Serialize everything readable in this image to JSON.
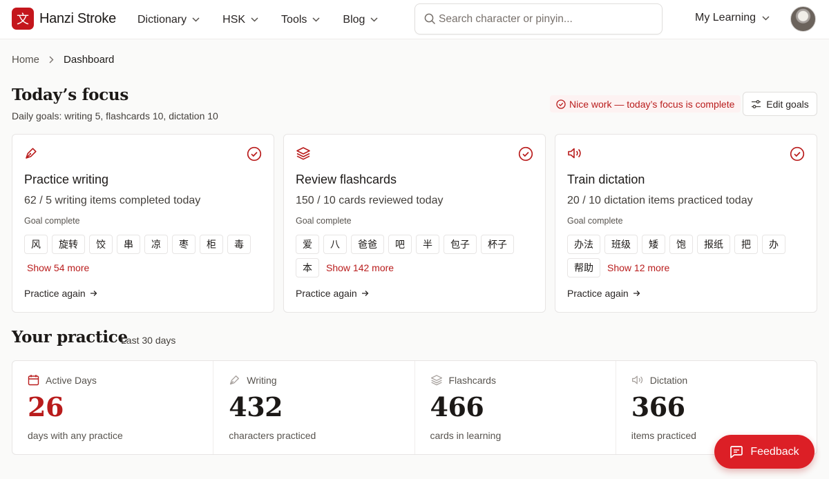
{
  "header": {
    "logo_glyph": "文",
    "app_name": "Hanzi Stroke",
    "nav": [
      {
        "label": "Dictionary"
      },
      {
        "label": "HSK"
      },
      {
        "label": "Tools"
      },
      {
        "label": "Blog"
      }
    ],
    "search_placeholder": "Search character or pinyin...",
    "my_learning": "My Learning",
    "icons": {
      "search": "search-icon",
      "chevron": "chevron-down-icon",
      "avatar": "user-avatar"
    }
  },
  "breadcrumb": {
    "home": "Home",
    "current": "Dashboard"
  },
  "focus": {
    "title": "Today’s focus",
    "subtitle": "Daily goals: writing 5, flashcards 10, dictation 10",
    "complete_text": "Nice work — today’s focus is complete",
    "edit_goals": "Edit goals",
    "cards": [
      {
        "icon": "pen-icon",
        "title": "Practice writing",
        "desc": "62 / 5 writing items completed today",
        "goal": "Goal complete",
        "chips": [
          "风",
          "旋转",
          "饺",
          "串",
          "凉",
          "枣",
          "柜",
          "毒"
        ],
        "more": "Show 54 more",
        "action": "Practice again"
      },
      {
        "icon": "layers-icon",
        "title": "Review flashcards",
        "desc": "150 / 10 cards reviewed today",
        "goal": "Goal complete",
        "chips": [
          "爱",
          "八",
          "爸爸",
          "吧",
          "半",
          "包子",
          "杯子",
          "本"
        ],
        "more": "Show 142 more",
        "action": "Practice again"
      },
      {
        "icon": "speaker-icon",
        "title": "Train dictation",
        "desc": "20 / 10 dictation items practiced today",
        "goal": "Goal complete",
        "chips": [
          "办法",
          "班级",
          "矮",
          "饱",
          "报纸",
          "把",
          "办",
          "帮助"
        ],
        "more": "Show 12 more",
        "action": "Practice again"
      }
    ]
  },
  "practice": {
    "title": "Your practice",
    "subtitle": "Last 30 days",
    "stats": [
      {
        "icon": "calendar-icon",
        "label": "Active Days",
        "value": "26",
        "caption": "days with any practice"
      },
      {
        "icon": "pen-icon",
        "label": "Writing",
        "value": "432",
        "caption": "characters practiced"
      },
      {
        "icon": "layers-icon",
        "label": "Flashcards",
        "value": "466",
        "caption": "cards in learning"
      },
      {
        "icon": "speaker-icon",
        "label": "Dictation",
        "value": "366",
        "caption": "items practiced"
      }
    ]
  },
  "feedback": {
    "label": "Feedback"
  },
  "colors": {
    "accent": "#c4161c",
    "accent_text": "#b91c1c",
    "feedback_bg": "#dc1f26"
  }
}
